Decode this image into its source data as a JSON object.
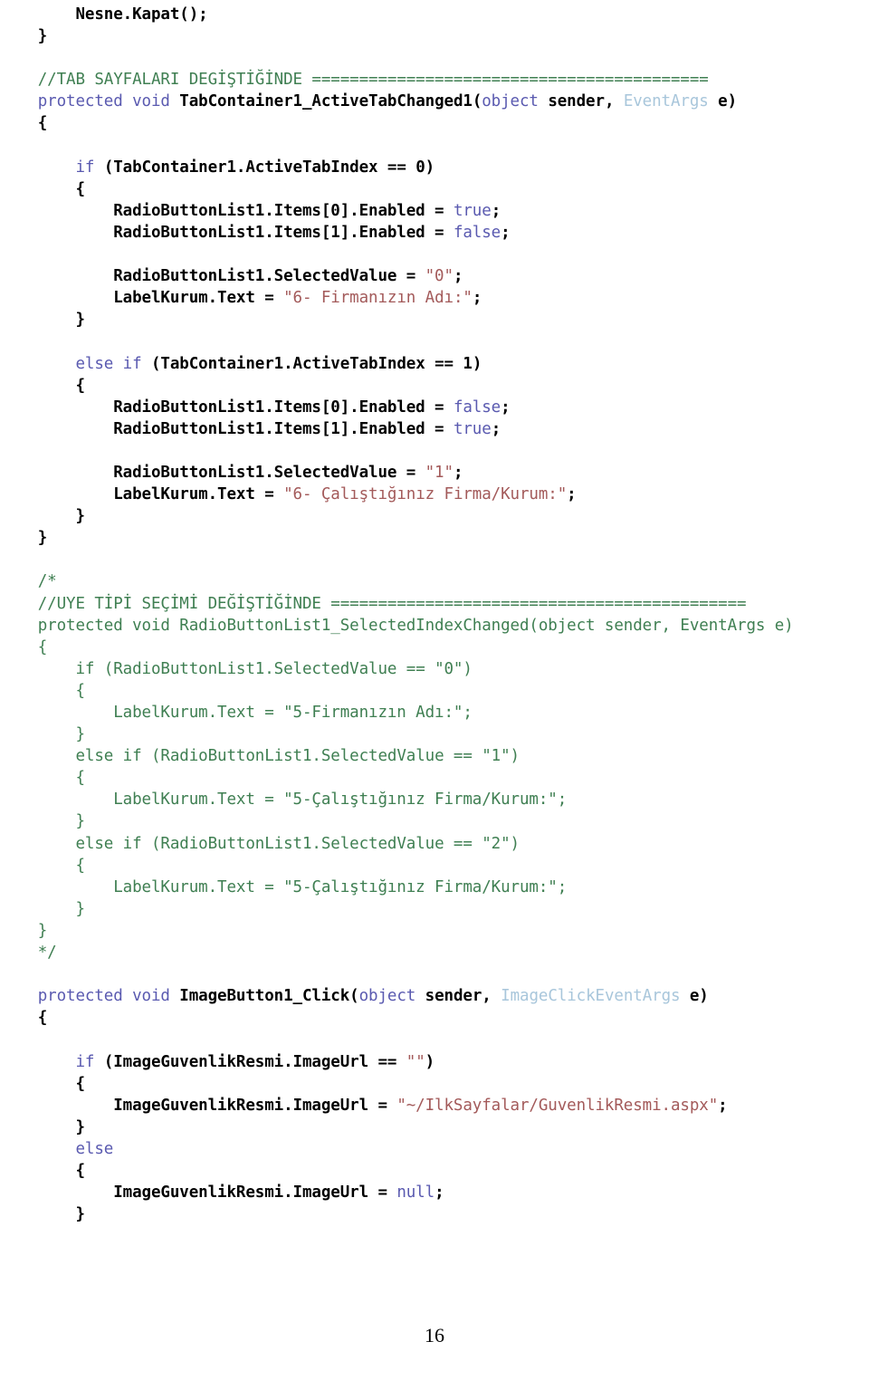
{
  "document": {
    "page_number": "16",
    "language": "csharp",
    "colors": {
      "keyword": "#5a5ab0",
      "identifier": "#000000",
      "string": "#a35a5a",
      "comment": "#3f7f52",
      "type": "#a8c6db",
      "background": "#ffffff"
    }
  },
  "code": {
    "lines": [
      {
        "id": "l01",
        "tokens": [
          {
            "t": "pl",
            "v": "        "
          },
          {
            "t": "id",
            "v": "Nesne.Kapat();"
          }
        ]
      },
      {
        "id": "l02",
        "tokens": [
          {
            "t": "pl",
            "v": "    "
          },
          {
            "t": "id",
            "v": "}"
          }
        ]
      },
      {
        "id": "l03",
        "tokens": []
      },
      {
        "id": "l04",
        "tokens": [
          {
            "t": "cm",
            "v": "    //TAB SAYFALARI DEGİŞTİĞİNDE =========================================="
          }
        ]
      },
      {
        "id": "l05",
        "tokens": [
          {
            "t": "kw",
            "v": "    protected void "
          },
          {
            "t": "id",
            "v": "TabContainer1_ActiveTabChanged1"
          },
          {
            "t": "pl",
            "v": "("
          },
          {
            "t": "kw",
            "v": "object "
          },
          {
            "t": "id",
            "v": "sender"
          },
          {
            "t": "pl",
            "v": ", "
          },
          {
            "t": "type",
            "v": "EventArgs "
          },
          {
            "t": "id",
            "v": "e)"
          }
        ]
      },
      {
        "id": "l06",
        "tokens": [
          {
            "t": "pl",
            "v": "    "
          },
          {
            "t": "id",
            "v": "{"
          }
        ]
      },
      {
        "id": "l07",
        "tokens": []
      },
      {
        "id": "l08",
        "tokens": [
          {
            "t": "kw",
            "v": "        if "
          },
          {
            "t": "id",
            "v": "(TabContainer1.ActiveTabIndex == 0)"
          }
        ]
      },
      {
        "id": "l09",
        "tokens": [
          {
            "t": "pl",
            "v": "        "
          },
          {
            "t": "id",
            "v": "{"
          }
        ]
      },
      {
        "id": "l10",
        "tokens": [
          {
            "t": "id",
            "v": "            RadioButtonList1.Items[0].Enabled = "
          },
          {
            "t": "kw",
            "v": "true"
          },
          {
            "t": "id",
            "v": ";"
          }
        ]
      },
      {
        "id": "l11",
        "tokens": [
          {
            "t": "id",
            "v": "            RadioButtonList1.Items[1].Enabled = "
          },
          {
            "t": "kw",
            "v": "false"
          },
          {
            "t": "id",
            "v": ";"
          }
        ]
      },
      {
        "id": "l12",
        "tokens": []
      },
      {
        "id": "l13",
        "tokens": [
          {
            "t": "id",
            "v": "            RadioButtonList1.SelectedValue = "
          },
          {
            "t": "str",
            "v": "\"0\""
          },
          {
            "t": "id",
            "v": ";"
          }
        ]
      },
      {
        "id": "l14",
        "tokens": [
          {
            "t": "id",
            "v": "            LabelKurum.Text = "
          },
          {
            "t": "str",
            "v": "\"6- Firmanızın Adı:\""
          },
          {
            "t": "id",
            "v": ";"
          }
        ]
      },
      {
        "id": "l15",
        "tokens": [
          {
            "t": "pl",
            "v": "        "
          },
          {
            "t": "id",
            "v": "}"
          }
        ]
      },
      {
        "id": "l16",
        "tokens": []
      },
      {
        "id": "l17",
        "tokens": [
          {
            "t": "kw",
            "v": "        else if "
          },
          {
            "t": "id",
            "v": "(TabContainer1.ActiveTabIndex == 1)"
          }
        ]
      },
      {
        "id": "l18",
        "tokens": [
          {
            "t": "pl",
            "v": "        "
          },
          {
            "t": "id",
            "v": "{"
          }
        ]
      },
      {
        "id": "l19",
        "tokens": [
          {
            "t": "id",
            "v": "            RadioButtonList1.Items[0].Enabled = "
          },
          {
            "t": "kw",
            "v": "false"
          },
          {
            "t": "id",
            "v": ";"
          }
        ]
      },
      {
        "id": "l20",
        "tokens": [
          {
            "t": "id",
            "v": "            RadioButtonList1.Items[1].Enabled = "
          },
          {
            "t": "kw",
            "v": "true"
          },
          {
            "t": "id",
            "v": ";"
          }
        ]
      },
      {
        "id": "l21",
        "tokens": []
      },
      {
        "id": "l22",
        "tokens": [
          {
            "t": "id",
            "v": "            RadioButtonList1.SelectedValue = "
          },
          {
            "t": "str",
            "v": "\"1\""
          },
          {
            "t": "id",
            "v": ";"
          }
        ]
      },
      {
        "id": "l23",
        "tokens": [
          {
            "t": "id",
            "v": "            LabelKurum.Text = "
          },
          {
            "t": "str",
            "v": "\"6- Çalıştığınız Firma/Kurum:\""
          },
          {
            "t": "id",
            "v": ";"
          }
        ]
      },
      {
        "id": "l24",
        "tokens": [
          {
            "t": "pl",
            "v": "        "
          },
          {
            "t": "id",
            "v": "}"
          }
        ]
      },
      {
        "id": "l25",
        "tokens": [
          {
            "t": "pl",
            "v": "    "
          },
          {
            "t": "id",
            "v": "}"
          }
        ]
      },
      {
        "id": "l26",
        "tokens": []
      },
      {
        "id": "l27",
        "tokens": [
          {
            "t": "cm",
            "v": "    /*"
          }
        ]
      },
      {
        "id": "l28",
        "tokens": [
          {
            "t": "cm",
            "v": "    //UYE TİPİ SEÇİMİ DEĞİŞTİĞİNDE ============================================"
          }
        ]
      },
      {
        "id": "l29",
        "tokens": [
          {
            "t": "cm",
            "v": "    protected void RadioButtonList1_SelectedIndexChanged(object sender, EventArgs e)"
          }
        ]
      },
      {
        "id": "l30",
        "tokens": [
          {
            "t": "cm",
            "v": "    {"
          }
        ]
      },
      {
        "id": "l31",
        "tokens": [
          {
            "t": "cm",
            "v": "        if (RadioButtonList1.SelectedValue == \"0\")"
          }
        ]
      },
      {
        "id": "l32",
        "tokens": [
          {
            "t": "cm",
            "v": "        {"
          }
        ]
      },
      {
        "id": "l33",
        "tokens": [
          {
            "t": "cm",
            "v": "            LabelKurum.Text = \"5-Firmanızın Adı:\";"
          }
        ]
      },
      {
        "id": "l34",
        "tokens": [
          {
            "t": "cm",
            "v": "        }"
          }
        ]
      },
      {
        "id": "l35",
        "tokens": [
          {
            "t": "cm",
            "v": "        else if (RadioButtonList1.SelectedValue == \"1\")"
          }
        ]
      },
      {
        "id": "l36",
        "tokens": [
          {
            "t": "cm",
            "v": "        {"
          }
        ]
      },
      {
        "id": "l37",
        "tokens": [
          {
            "t": "cm",
            "v": "            LabelKurum.Text = \"5-Çalıştığınız Firma/Kurum:\";"
          }
        ]
      },
      {
        "id": "l38",
        "tokens": [
          {
            "t": "cm",
            "v": "        }"
          }
        ]
      },
      {
        "id": "l39",
        "tokens": [
          {
            "t": "cm",
            "v": "        else if (RadioButtonList1.SelectedValue == \"2\")"
          }
        ]
      },
      {
        "id": "l40",
        "tokens": [
          {
            "t": "cm",
            "v": "        {"
          }
        ]
      },
      {
        "id": "l41",
        "tokens": [
          {
            "t": "cm",
            "v": "            LabelKurum.Text = \"5-Çalıştığınız Firma/Kurum:\";"
          }
        ]
      },
      {
        "id": "l42",
        "tokens": [
          {
            "t": "cm",
            "v": "        }"
          }
        ]
      },
      {
        "id": "l43",
        "tokens": [
          {
            "t": "cm",
            "v": "    }"
          }
        ]
      },
      {
        "id": "l44",
        "tokens": [
          {
            "t": "cm",
            "v": "    */"
          }
        ]
      },
      {
        "id": "l45",
        "tokens": []
      },
      {
        "id": "l46",
        "tokens": [
          {
            "t": "kw",
            "v": "    protected void "
          },
          {
            "t": "id",
            "v": "ImageButton1_Click"
          },
          {
            "t": "pl",
            "v": "("
          },
          {
            "t": "kw",
            "v": "object "
          },
          {
            "t": "id",
            "v": "sender"
          },
          {
            "t": "pl",
            "v": ", "
          },
          {
            "t": "type",
            "v": "ImageClickEventArgs "
          },
          {
            "t": "id",
            "v": "e)"
          }
        ]
      },
      {
        "id": "l47",
        "tokens": [
          {
            "t": "pl",
            "v": "    "
          },
          {
            "t": "id",
            "v": "{"
          }
        ]
      },
      {
        "id": "l48",
        "tokens": []
      },
      {
        "id": "l49",
        "tokens": [
          {
            "t": "kw",
            "v": "        if "
          },
          {
            "t": "id",
            "v": "(ImageGuvenlikResmi.ImageUrl == "
          },
          {
            "t": "str",
            "v": "\"\""
          },
          {
            "t": "id",
            "v": ")"
          }
        ]
      },
      {
        "id": "l50",
        "tokens": [
          {
            "t": "pl",
            "v": "        "
          },
          {
            "t": "id",
            "v": "{"
          }
        ]
      },
      {
        "id": "l51",
        "tokens": [
          {
            "t": "id",
            "v": "            ImageGuvenlikResmi.ImageUrl = "
          },
          {
            "t": "str",
            "v": "\"~/IlkSayfalar/GuvenlikResmi.aspx\""
          },
          {
            "t": "id",
            "v": ";"
          }
        ]
      },
      {
        "id": "l52",
        "tokens": [
          {
            "t": "pl",
            "v": "        "
          },
          {
            "t": "id",
            "v": "}"
          }
        ]
      },
      {
        "id": "l53",
        "tokens": [
          {
            "t": "kw",
            "v": "        else"
          }
        ]
      },
      {
        "id": "l54",
        "tokens": [
          {
            "t": "pl",
            "v": "        "
          },
          {
            "t": "id",
            "v": "{"
          }
        ]
      },
      {
        "id": "l55",
        "tokens": [
          {
            "t": "id",
            "v": "            ImageGuvenlikResmi.ImageUrl = "
          },
          {
            "t": "kw",
            "v": "null"
          },
          {
            "t": "id",
            "v": ";"
          }
        ]
      },
      {
        "id": "l56",
        "tokens": [
          {
            "t": "pl",
            "v": "        "
          },
          {
            "t": "id",
            "v": "}"
          }
        ]
      }
    ]
  }
}
